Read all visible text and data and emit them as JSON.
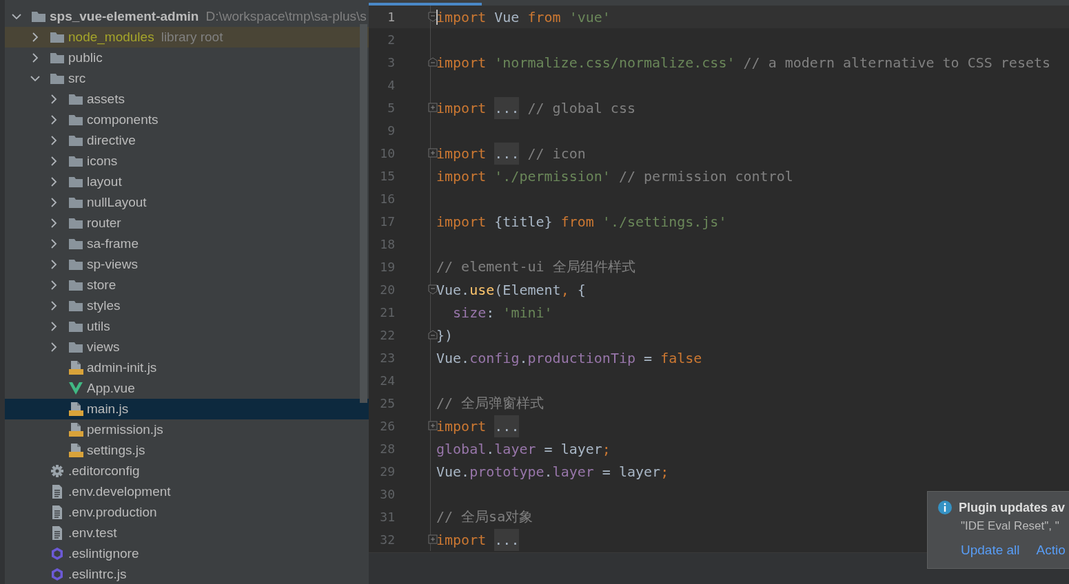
{
  "project_tree": {
    "items": [
      {
        "label": "sps_vue-element-admin",
        "kind": "folder",
        "path": "D:\\workspace\\tmp\\sa-plus\\s",
        "expanded": true,
        "selected": false,
        "children": [
          {
            "label": "node_modules",
            "kind": "folder",
            "tag": "library root",
            "library": true,
            "expanded": false,
            "selected": false
          },
          {
            "label": "public",
            "kind": "folder",
            "expanded": false,
            "selected": false
          },
          {
            "label": "src",
            "kind": "folder",
            "expanded": true,
            "selected": false,
            "children": [
              {
                "label": "assets",
                "kind": "folder",
                "expanded": false,
                "selected": false
              },
              {
                "label": "components",
                "kind": "folder",
                "expanded": false,
                "selected": false
              },
              {
                "label": "directive",
                "kind": "folder",
                "expanded": false,
                "selected": false
              },
              {
                "label": "icons",
                "kind": "folder",
                "expanded": false,
                "selected": false
              },
              {
                "label": "layout",
                "kind": "folder",
                "expanded": false,
                "selected": false
              },
              {
                "label": "nullLayout",
                "kind": "folder",
                "expanded": false,
                "selected": false
              },
              {
                "label": "router",
                "kind": "folder",
                "expanded": false,
                "selected": false
              },
              {
                "label": "sa-frame",
                "kind": "folder",
                "expanded": false,
                "selected": false
              },
              {
                "label": "sp-views",
                "kind": "folder",
                "expanded": false,
                "selected": false
              },
              {
                "label": "store",
                "kind": "folder",
                "expanded": false,
                "selected": false
              },
              {
                "label": "styles",
                "kind": "folder",
                "expanded": false,
                "selected": false
              },
              {
                "label": "utils",
                "kind": "folder",
                "expanded": false,
                "selected": false
              },
              {
                "label": "views",
                "kind": "folder",
                "expanded": false,
                "selected": false
              },
              {
                "label": "admin-init.js",
                "kind": "js",
                "selected": false
              },
              {
                "label": "App.vue",
                "kind": "vue",
                "selected": false
              },
              {
                "label": "main.js",
                "kind": "js",
                "selected": true
              },
              {
                "label": "permission.js",
                "kind": "js",
                "selected": false
              },
              {
                "label": "settings.js",
                "kind": "js",
                "selected": false
              }
            ]
          },
          {
            "label": ".editorconfig",
            "kind": "config",
            "selected": false
          },
          {
            "label": ".env.development",
            "kind": "text",
            "selected": false
          },
          {
            "label": ".env.production",
            "kind": "text",
            "selected": false
          },
          {
            "label": ".env.test",
            "kind": "text",
            "selected": false
          },
          {
            "label": ".eslintignore",
            "kind": "eslint",
            "selected": false
          },
          {
            "label": ".eslintrc.js",
            "kind": "eslint",
            "selected": false
          }
        ]
      }
    ]
  },
  "editor": {
    "lines": [
      {
        "num": "1",
        "fold_marker": {
          "kind": "start"
        },
        "current": true,
        "tokens": [
          {
            "text": "import",
            "kind": "keyword"
          },
          {
            "text": " Vue ",
            "kind": "plain"
          },
          {
            "text": "from",
            "kind": "keyword"
          },
          {
            "text": " 'vue'",
            "kind": "string"
          }
        ]
      },
      {
        "num": "2",
        "current": false
      },
      {
        "num": "3",
        "fold_marker": {
          "kind": "end"
        },
        "current": false,
        "tokens": [
          {
            "text": "import",
            "kind": "keyword"
          },
          {
            "text": " 'normalize.css/normalize.css'",
            "kind": "string"
          },
          {
            "text": " // a modern alternative to CSS resets",
            "kind": "comment"
          }
        ]
      },
      {
        "num": "4",
        "current": false
      },
      {
        "num": "5",
        "fold_marker": {
          "kind": "collapsed"
        },
        "current": false,
        "tokens": [
          {
            "text": "import ",
            "kind": "keyword"
          },
          {
            "text": "...",
            "kind": "folded"
          },
          {
            "text": " // global css",
            "kind": "comment"
          }
        ]
      },
      {
        "num": "9",
        "current": false
      },
      {
        "num": "10",
        "fold_marker": {
          "kind": "collapsed"
        },
        "current": false,
        "tokens": [
          {
            "text": "import ",
            "kind": "keyword"
          },
          {
            "text": "...",
            "kind": "folded"
          },
          {
            "text": " // icon",
            "kind": "comment"
          }
        ]
      },
      {
        "num": "15",
        "current": false,
        "tokens": [
          {
            "text": "import",
            "kind": "keyword"
          },
          {
            "text": " './permission'",
            "kind": "string"
          },
          {
            "text": " // permission control",
            "kind": "comment"
          }
        ]
      },
      {
        "num": "16",
        "current": false
      },
      {
        "num": "17",
        "current": false,
        "tokens": [
          {
            "text": "import",
            "kind": "keyword"
          },
          {
            "text": " {title} ",
            "kind": "plain"
          },
          {
            "text": "from",
            "kind": "keyword"
          },
          {
            "text": " './settings.js'",
            "kind": "string"
          }
        ]
      },
      {
        "num": "18",
        "current": false
      },
      {
        "num": "19",
        "current": false,
        "tokens": [
          {
            "text": "// element-ui 全局组件样式",
            "kind": "comment"
          }
        ]
      },
      {
        "num": "20",
        "fold_marker": {
          "kind": "start"
        },
        "current": false,
        "tokens": [
          {
            "text": "Vue.",
            "kind": "plain"
          },
          {
            "text": "use",
            "kind": "function"
          },
          {
            "text": "(Element",
            "kind": "plain"
          },
          {
            "text": ",",
            "kind": "keyword"
          },
          {
            "text": " {",
            "kind": "plain"
          }
        ]
      },
      {
        "num": "21",
        "current": false,
        "tokens": [
          {
            "text": "  size",
            "kind": "property"
          },
          {
            "text": ": ",
            "kind": "plain"
          },
          {
            "text": "'mini'",
            "kind": "string"
          }
        ]
      },
      {
        "num": "22",
        "fold_marker": {
          "kind": "end"
        },
        "current": false,
        "tokens": [
          {
            "text": "})",
            "kind": "plain"
          }
        ]
      },
      {
        "num": "23",
        "current": false,
        "tokens": [
          {
            "text": "Vue.",
            "kind": "plain"
          },
          {
            "text": "config",
            "kind": "property"
          },
          {
            "text": ".",
            "kind": "plain"
          },
          {
            "text": "productionTip",
            "kind": "property"
          },
          {
            "text": " = ",
            "kind": "plain"
          },
          {
            "text": "false",
            "kind": "keyword"
          }
        ]
      },
      {
        "num": "24",
        "current": false
      },
      {
        "num": "25",
        "current": false,
        "tokens": [
          {
            "text": "// 全局弹窗样式",
            "kind": "comment"
          }
        ]
      },
      {
        "num": "26",
        "fold_marker": {
          "kind": "collapsed"
        },
        "current": false,
        "tokens": [
          {
            "text": "import ",
            "kind": "keyword"
          },
          {
            "text": "...",
            "kind": "folded"
          }
        ]
      },
      {
        "num": "28",
        "current": false,
        "tokens": [
          {
            "text": "global",
            "kind": "property"
          },
          {
            "text": ".",
            "kind": "plain"
          },
          {
            "text": "layer",
            "kind": "property"
          },
          {
            "text": " = layer",
            "kind": "plain"
          },
          {
            "text": ";",
            "kind": "keyword"
          }
        ]
      },
      {
        "num": "29",
        "current": false,
        "tokens": [
          {
            "text": "Vue.",
            "kind": "plain"
          },
          {
            "text": "prototype",
            "kind": "property"
          },
          {
            "text": ".",
            "kind": "plain"
          },
          {
            "text": "layer",
            "kind": "property"
          },
          {
            "text": " = layer",
            "kind": "plain"
          },
          {
            "text": ";",
            "kind": "keyword"
          }
        ]
      },
      {
        "num": "30",
        "current": false
      },
      {
        "num": "31",
        "current": false,
        "tokens": [
          {
            "text": "// 全局sa对象",
            "kind": "comment"
          }
        ]
      },
      {
        "num": "32",
        "fold_marker": {
          "kind": "collapsed"
        },
        "current": false,
        "tokens": [
          {
            "text": "import ",
            "kind": "keyword"
          },
          {
            "text": "...",
            "kind": "folded"
          }
        ]
      }
    ]
  },
  "notification": {
    "title": "Plugin updates av",
    "text": "\"IDE Eval Reset\", \"",
    "actions": [
      "Update all",
      "Actio"
    ]
  }
}
